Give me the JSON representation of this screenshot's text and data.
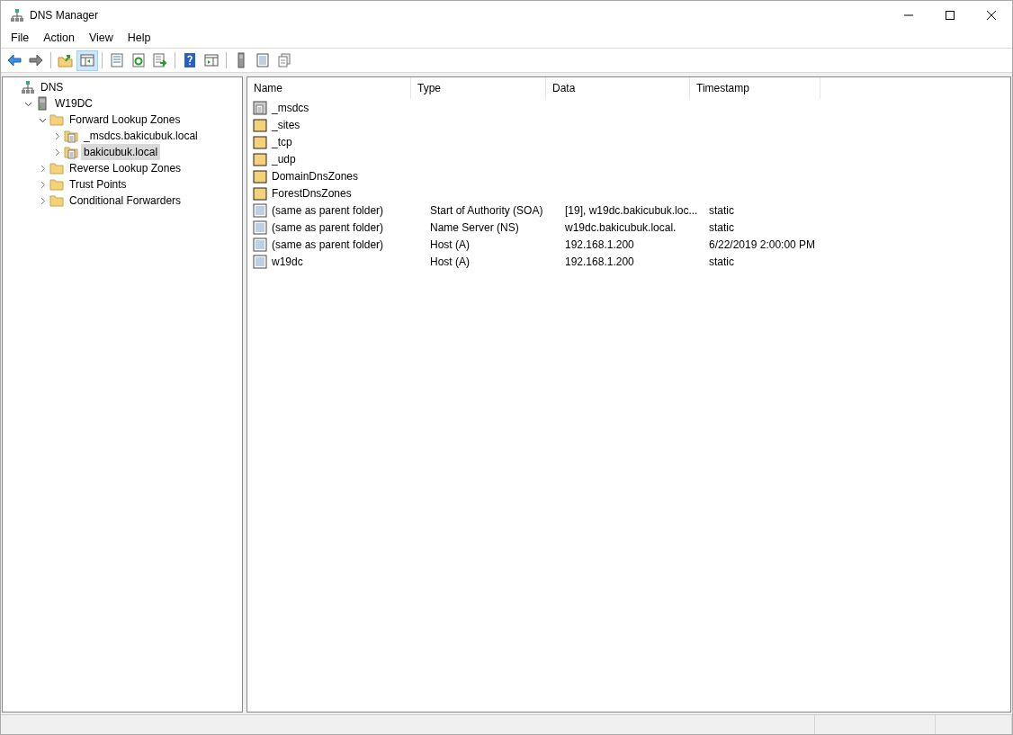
{
  "window": {
    "title": "DNS Manager"
  },
  "menu": [
    "File",
    "Action",
    "View",
    "Help"
  ],
  "toolbar": [
    [
      {
        "kind": "back",
        "pressed": false
      },
      {
        "kind": "forward",
        "pressed": false
      }
    ],
    [
      {
        "kind": "up-folder",
        "pressed": false
      },
      {
        "kind": "tree-toggle",
        "pressed": true
      }
    ],
    [
      {
        "kind": "properties",
        "pressed": false
      },
      {
        "kind": "refresh",
        "pressed": false
      },
      {
        "kind": "export",
        "pressed": false
      }
    ],
    [
      {
        "kind": "help",
        "pressed": false
      },
      {
        "kind": "action-pane",
        "pressed": false
      }
    ],
    [
      {
        "kind": "server",
        "pressed": false
      },
      {
        "kind": "record",
        "pressed": false
      },
      {
        "kind": "copy",
        "pressed": false
      }
    ]
  ],
  "tree": [
    {
      "label": "DNS",
      "kind": "network",
      "selected": false,
      "children": [
        {
          "label": "W19DC",
          "kind": "server",
          "expanded": true,
          "selected": false,
          "children": [
            {
              "label": "Forward Lookup Zones",
              "kind": "folder",
              "expanded": true,
              "selected": false,
              "children": [
                {
                  "label": "_msdcs.bakicubuk.local",
                  "kind": "zone",
                  "expanded": false,
                  "selected": false
                },
                {
                  "label": "bakicubuk.local",
                  "kind": "zone",
                  "expanded": false,
                  "selected": true
                }
              ]
            },
            {
              "label": "Reverse Lookup Zones",
              "kind": "folder",
              "expanded": false,
              "selected": false
            },
            {
              "label": "Trust Points",
              "kind": "folder",
              "expanded": false,
              "selected": false
            },
            {
              "label": "Conditional Forwarders",
              "kind": "folder",
              "expanded": false,
              "selected": false
            }
          ]
        }
      ]
    }
  ],
  "table": {
    "columns": [
      "Name",
      "Type",
      "Data",
      "Timestamp"
    ],
    "rows": [
      {
        "kind": "zone",
        "cells": [
          "_msdcs",
          "",
          "",
          ""
        ]
      },
      {
        "kind": "folder",
        "cells": [
          "_sites",
          "",
          "",
          ""
        ]
      },
      {
        "kind": "folder",
        "cells": [
          "_tcp",
          "",
          "",
          ""
        ]
      },
      {
        "kind": "folder",
        "cells": [
          "_udp",
          "",
          "",
          ""
        ]
      },
      {
        "kind": "folder",
        "cells": [
          "DomainDnsZones",
          "",
          "",
          ""
        ]
      },
      {
        "kind": "folder",
        "cells": [
          "ForestDnsZones",
          "",
          "",
          ""
        ]
      },
      {
        "kind": "record",
        "cells": [
          "(same as parent folder)",
          "Start of Authority (SOA)",
          "[19], w19dc.bakicubuk.loc...",
          "static"
        ]
      },
      {
        "kind": "record",
        "cells": [
          "(same as parent folder)",
          "Name Server (NS)",
          "w19dc.bakicubuk.local.",
          "static"
        ]
      },
      {
        "kind": "record",
        "cells": [
          "(same as parent folder)",
          "Host (A)",
          "192.168.1.200",
          "6/22/2019 2:00:00 PM"
        ]
      },
      {
        "kind": "record",
        "cells": [
          "w19dc",
          "Host (A)",
          "192.168.1.200",
          "static"
        ]
      }
    ]
  }
}
